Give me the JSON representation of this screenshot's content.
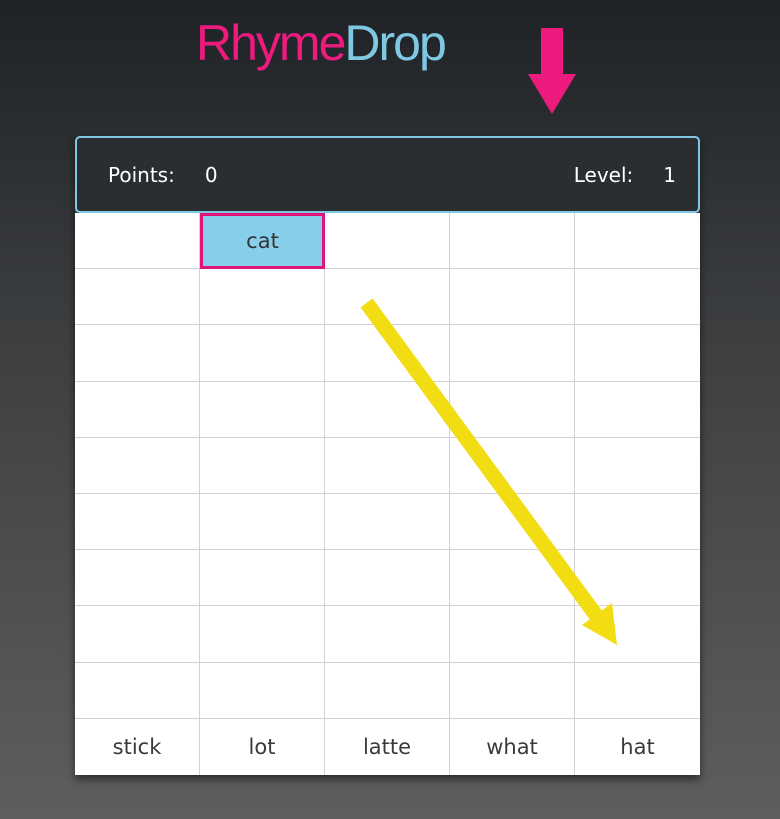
{
  "logo": {
    "part1": "Rhyme",
    "part2": "Drop",
    "color1": "#ee1b7f",
    "color2": "#7fc8e4"
  },
  "scorebar": {
    "points_label": "Points:",
    "points_value": "0",
    "level_label": "Level:",
    "level_value": "1"
  },
  "grid": {
    "columns": 5,
    "rows": 10,
    "falling_word": {
      "text": "cat",
      "row": 0,
      "col": 1
    },
    "bottom_words": [
      "stick",
      "lot",
      "latte",
      "what",
      "hat"
    ]
  },
  "hint": {
    "type": "arrow",
    "from_col": 2,
    "to_col": 4,
    "color": "#f2dd12"
  },
  "colors": {
    "accent_pink": "#e0147a",
    "accent_blue": "#7fc8e4",
    "falling_block": "#87ceeb",
    "scorebar_bg": "#2b2e31",
    "hint_arrow": "#f2dd12"
  }
}
